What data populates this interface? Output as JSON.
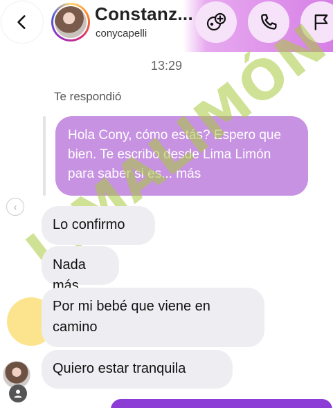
{
  "header": {
    "contact_name": "Constanz...",
    "contact_handle": "conycapelli"
  },
  "timestamp": "13:29",
  "reply": {
    "label": "Te respondió",
    "quoted_message": "Hola Cony, cómo estás? Espero que bien. Te escribo desde Lima Limón para saber si es... más"
  },
  "messages": [
    {
      "text": "Lo confirmo"
    },
    {
      "text": "Nada más"
    },
    {
      "text": "Por mi bebé que viene en camino"
    },
    {
      "text": "Quiero estar tranquila"
    }
  ],
  "watermark": {
    "text": "LIMALIMÓN"
  },
  "colors": {
    "quoted_bubble": "#c792e2",
    "incoming_bubble": "#eeeef2",
    "outgoing_bubble": "#8c3dd6",
    "header_accent": "#d67fe6",
    "watermark": "#a7c83c"
  },
  "icons": [
    "chevron-left-icon",
    "add-video-call-icon",
    "phone-icon",
    "flag-icon",
    "reply-arrow-icon",
    "profile-icon"
  ]
}
